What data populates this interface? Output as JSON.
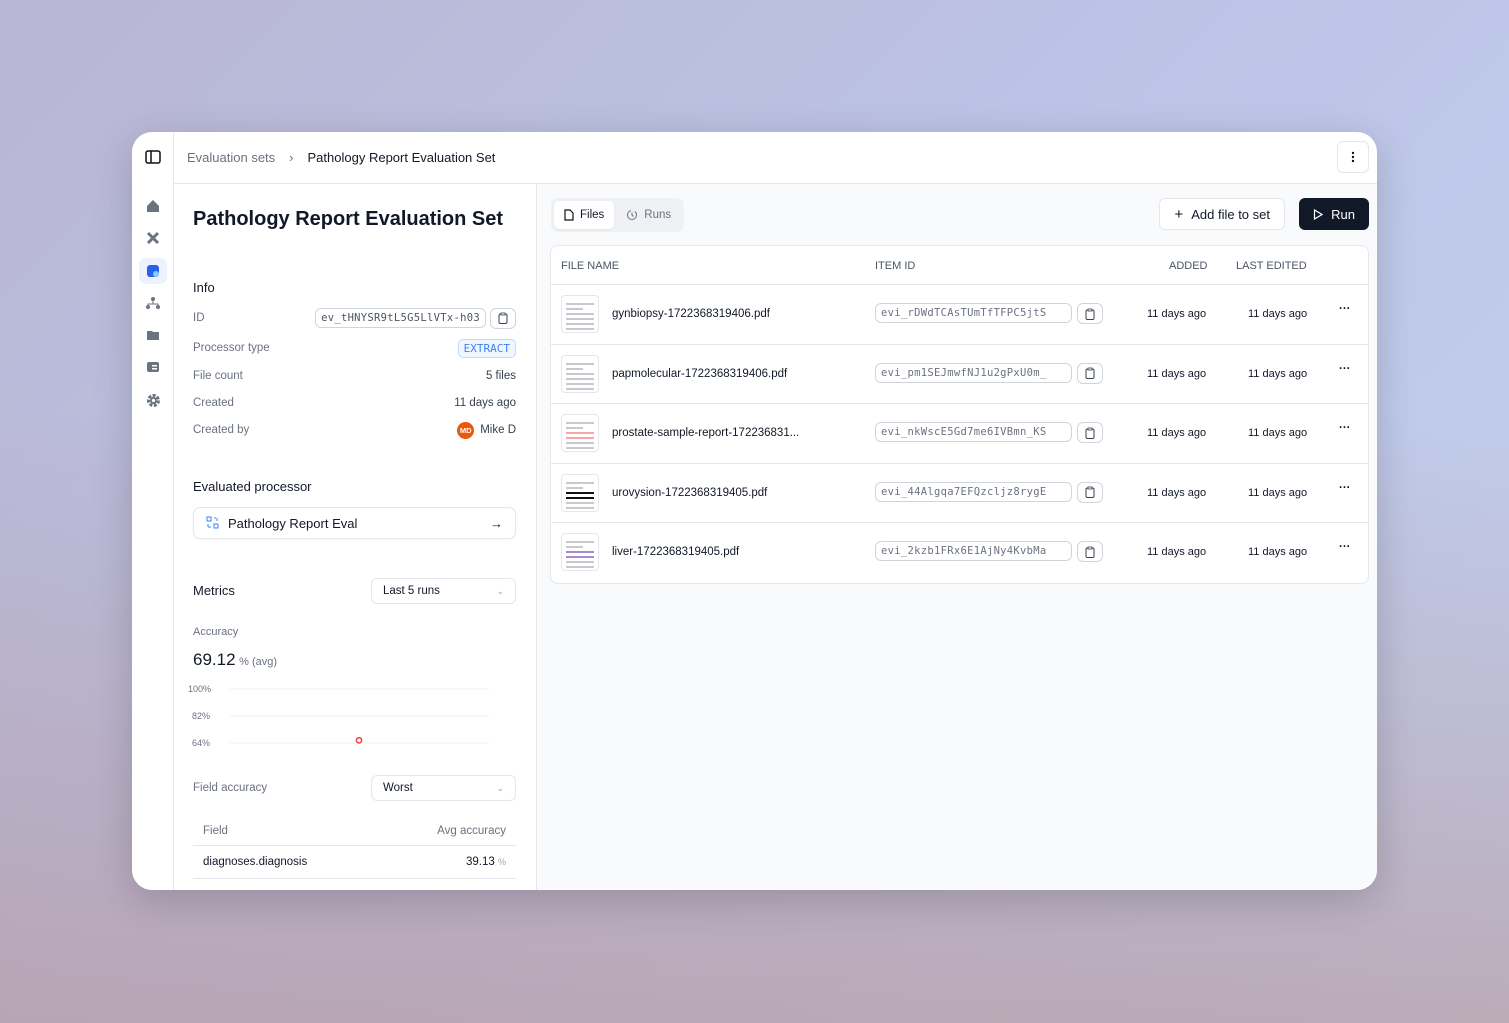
{
  "breadcrumb": {
    "parent": "Evaluation sets",
    "current": "Pathology Report Evaluation Set"
  },
  "title": "Pathology Report Evaluation Set",
  "info": {
    "heading": "Info",
    "id_label": "ID",
    "id_value": "ev_tHNYSR9tL5G5LlVTx-h03",
    "processor_type_label": "Processor type",
    "processor_type": "EXTRACT",
    "file_count_label": "File count",
    "file_count": "5 files",
    "created_label": "Created",
    "created": "11 days ago",
    "created_by_label": "Created by",
    "created_by_initials": "MD",
    "created_by": "Mike D"
  },
  "evaluated_processor": {
    "heading": "Evaluated processor",
    "name": "Pathology Report Eval"
  },
  "metrics": {
    "heading": "Metrics",
    "range": "Last 5 runs",
    "accuracy_label": "Accuracy",
    "accuracy_value": "69.12",
    "accuracy_unit": "% (avg)",
    "field_accuracy_label": "Field accuracy",
    "field_sort": "Worst",
    "table_headers": {
      "field": "Field",
      "avg": "Avg accuracy"
    },
    "fields": [
      {
        "name": "diagnoses.diagnosis",
        "value": "39.13",
        "unit": "%"
      }
    ]
  },
  "chart_data": {
    "type": "scatter",
    "title": "Accuracy",
    "y_ticks": [
      "100%",
      "82%",
      "64%"
    ],
    "ylim": [
      64,
      100
    ],
    "points": [
      {
        "run": 1,
        "value": 69.12
      }
    ],
    "color": "#ef4444"
  },
  "tabs": {
    "files": "Files",
    "runs": "Runs"
  },
  "actions": {
    "add": "Add file to set",
    "run": "Run"
  },
  "table": {
    "headers": {
      "file": "FILE NAME",
      "item": "ITEM ID",
      "added": "ADDED",
      "edited": "LAST EDITED"
    },
    "rows": [
      {
        "file": "gynbiopsy-1722368319406.pdf",
        "id": "evi_rDWdTCAsTUmTfTFPC5jtS",
        "added": "11 days ago",
        "edited": "11 days ago"
      },
      {
        "file": "papmolecular-1722368319406.pdf",
        "id": "evi_pm1SEJmwfNJ1u2gPxU0m_",
        "added": "11 days ago",
        "edited": "11 days ago"
      },
      {
        "file": "prostate-sample-report-172236831...",
        "id": "evi_nkWscE5Gd7me6IVBmn_KS",
        "added": "11 days ago",
        "edited": "11 days ago"
      },
      {
        "file": "urovysion-1722368319405.pdf",
        "id": "evi_44Algqa7EFQzcljz8rygE",
        "added": "11 days ago",
        "edited": "11 days ago"
      },
      {
        "file": "liver-1722368319405.pdf",
        "id": "evi_2kzb1FRx6E1AjNy4KvbMa",
        "added": "11 days ago",
        "edited": "11 days ago"
      }
    ]
  }
}
